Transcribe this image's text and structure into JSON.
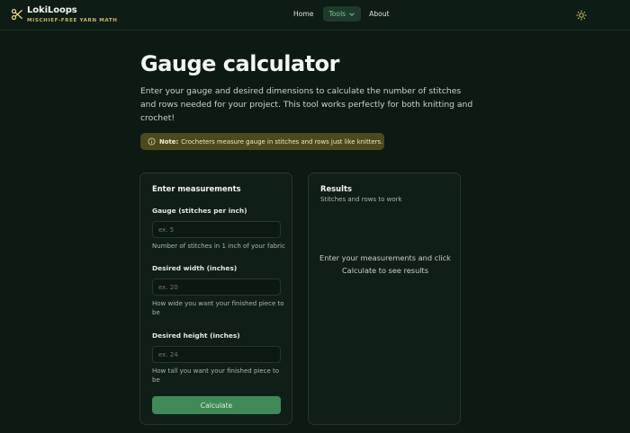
{
  "brand": {
    "name": "LokiLoops",
    "tagline": "MISCHIEF-FREE YARN MATH",
    "logo_icon": "scissors-icon"
  },
  "nav": {
    "home": "Home",
    "tools": "Tools",
    "about": "About",
    "theme_icon": "sun-icon"
  },
  "page": {
    "title": "Gauge calculator",
    "intro": "Enter your gauge and desired dimensions to calculate the number of stitches and rows needed for your project. This tool works perfectly for both knitting and crochet!",
    "note_label": "Note:",
    "note_text": "Crocheters measure gauge in stitches and rows just like knitters."
  },
  "form": {
    "title": "Enter measurements",
    "gauge": {
      "label": "Gauge (stitches per inch)",
      "placeholder": "ex. 5",
      "help": "Number of stitches in 1 inch of your fabric"
    },
    "width": {
      "label": "Desired width (inches)",
      "placeholder": "ex. 20",
      "help": "How wide you want your finished piece to be"
    },
    "height": {
      "label": "Desired height (inches)",
      "placeholder": "ex. 24",
      "help": "How tall you want your finished piece to be"
    },
    "button": "Calculate"
  },
  "results": {
    "title": "Results",
    "subtitle": "Stitches and rows to work",
    "empty": "Enter your measurements and click Calculate to see results"
  },
  "colors": {
    "background": "#0c1a13",
    "accent": "#3f8a57",
    "note_bg": "#4a4a1d",
    "tagline": "#c8b86a"
  }
}
